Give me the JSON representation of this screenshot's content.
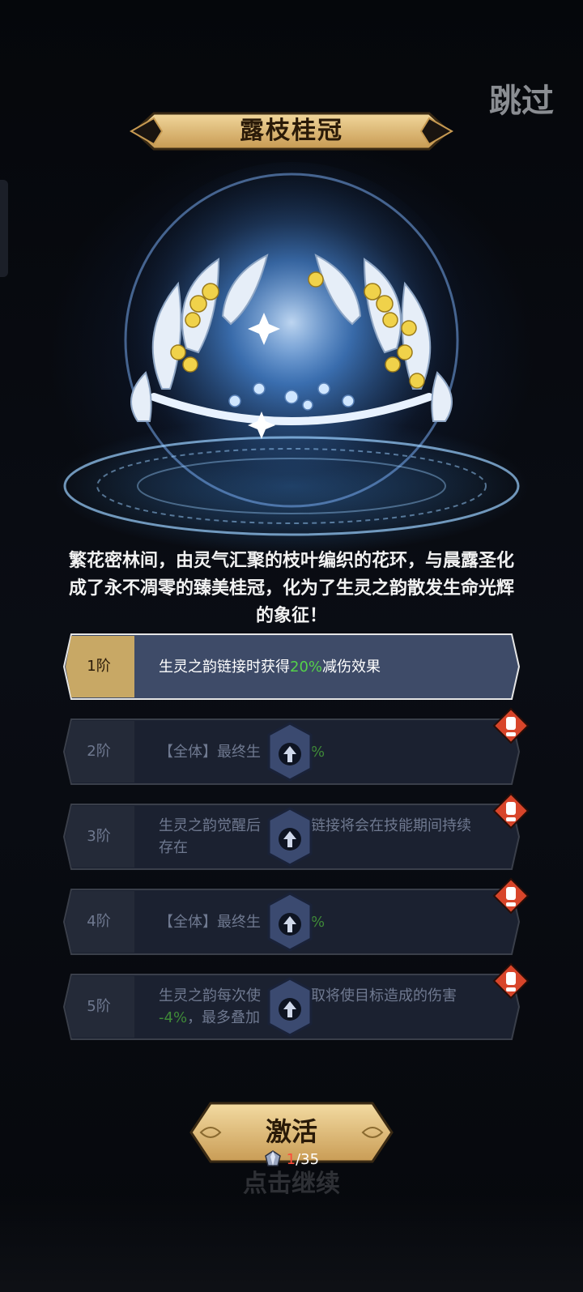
{
  "header": {
    "skip_label": "跳过",
    "title": "露枝桂冠"
  },
  "description": {
    "line1": "繁花密林间，由灵气汇聚的枝叶编织的花环，与晨露圣化",
    "line2": "成了永不凋零的臻美桂冠，化为了生灵之韵散发生命光辉",
    "line3": "的象征！"
  },
  "tiers": [
    {
      "label": "1阶",
      "text_before": "生灵之韵链接时获得",
      "highlight": "20%",
      "text_after": "减伤效果",
      "state": "active"
    },
    {
      "label": "2阶",
      "text_before": "【全体】最终生",
      "highlight": "%",
      "text_after": "",
      "state": "locked"
    },
    {
      "label": "3阶",
      "line1": "生灵之韵觉醒后",
      "line1_cont": "命链接将会在技能期间持续",
      "line2": "存在",
      "state": "locked"
    },
    {
      "label": "4阶",
      "text_before": "【全体】最终生",
      "highlight": "%",
      "text_after": "",
      "state": "locked"
    },
    {
      "label": "5阶",
      "line1": "生灵之韵每次使",
      "line1_cont": "命汲取将使目标造成的伤害",
      "highlight": "-4%",
      "line2_after": "，最多叠加",
      "state": "locked"
    }
  ],
  "activate": {
    "label": "激活",
    "cost_current": "1",
    "cost_total": "/35",
    "item_icon": "crystal-icon"
  },
  "continue_label": "点击继续",
  "colors": {
    "gold": "#d8b56c",
    "tier_active_bg": "#3e4b68",
    "tier_locked_bg": "#1b2130",
    "highlight_green": "#55d24a",
    "alert_red": "#d8452a"
  }
}
